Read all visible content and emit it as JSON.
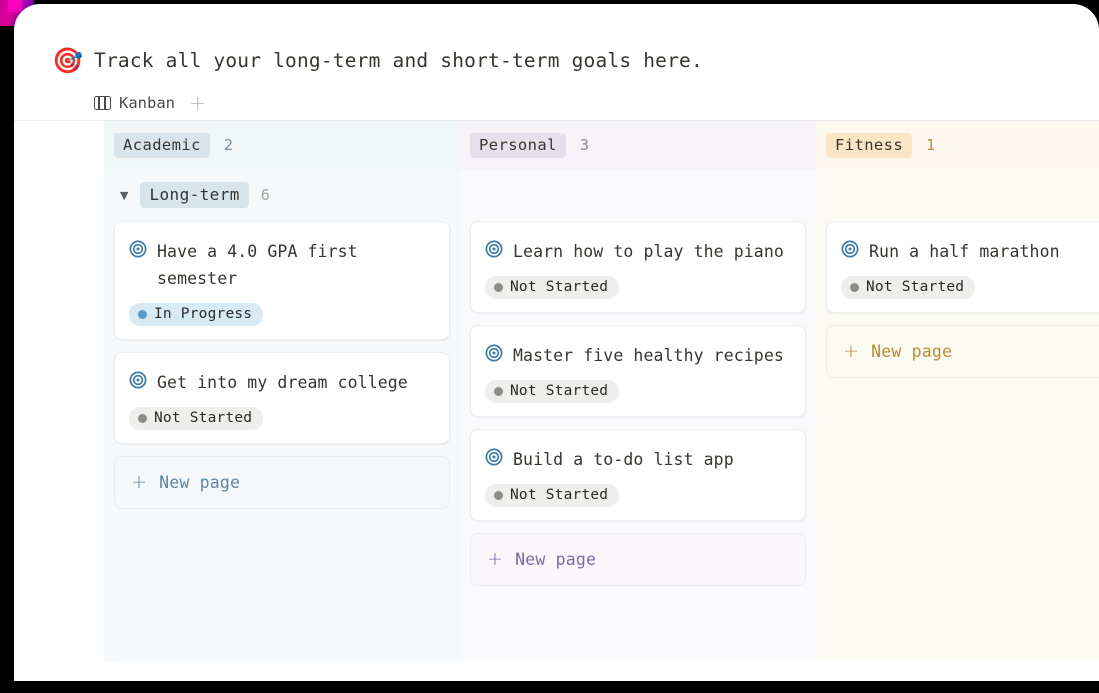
{
  "page": {
    "emoji": "🎯",
    "emoji_name": "direct-hit-target-emoji",
    "title": "Track all your long-term and short-term goals here."
  },
  "view_tabs": {
    "tabs": [
      {
        "label": "Kanban",
        "icon": "kanban-board-icon",
        "active": true
      }
    ],
    "add_label": "+"
  },
  "board": {
    "columns": [
      {
        "name": "Academic",
        "count": "2",
        "chip_bg": "#d8e5ec",
        "chip_color": "#37352f",
        "count_color": "#6d8d9e",
        "column_bg": "#f6f9fb",
        "header_bg": "#f1f6f9",
        "group": {
          "caret": "▼",
          "label": "Long-term",
          "count": "6"
        },
        "cards": [
          {
            "icon": "target-page-icon",
            "title": "Have a 4.0 GPA first semester",
            "status": "In Progress",
            "status_class": "status-in-progress"
          },
          {
            "icon": "target-page-icon",
            "title": "Get into my dream college",
            "status": "Not Started",
            "status_class": "status-not-started"
          }
        ],
        "new_page": {
          "label": "New page",
          "plus": "+",
          "bg": "#f4f8fa",
          "color": "#5b87a8",
          "border": "#e6eef3"
        }
      },
      {
        "name": "Personal",
        "count": "3",
        "chip_bg": "#e4e1ec",
        "chip_color": "#37352f",
        "count_color": "#8d86a3",
        "column_bg": "#faf9fc",
        "header_bg": "#f6f4f9",
        "group": null,
        "cards": [
          {
            "icon": "target-page-icon",
            "title": "Learn how to play the piano",
            "status": "Not Started",
            "status_class": "status-not-started"
          },
          {
            "icon": "target-page-icon",
            "title": "Master five healthy recipes",
            "status": "Not Started",
            "status_class": "status-not-started"
          },
          {
            "icon": "target-page-icon",
            "title": "Build a to-do list app",
            "status": "Not Started",
            "status_class": "status-not-started"
          }
        ],
        "new_page": {
          "label": "New page",
          "plus": "+",
          "bg": "#faf8fc",
          "color": "#7c6aab",
          "border": "#efeaf5"
        }
      },
      {
        "name": "Fitness",
        "count": "1",
        "chip_bg": "#fbe6c4",
        "chip_color": "#37352f",
        "count_color": "#c08c3e",
        "column_bg": "#fbfbf4",
        "header_bg": "#fdf8ee",
        "group": null,
        "cards": [
          {
            "icon": "target-page-icon",
            "title": "Run a half marathon",
            "status": "Not Started",
            "status_class": "status-not-started"
          }
        ],
        "new_page": {
          "label": "New page",
          "plus": "+",
          "bg": "#fcfbf2",
          "color": "#bf8c2f",
          "border": "#f3eedd"
        }
      }
    ]
  }
}
